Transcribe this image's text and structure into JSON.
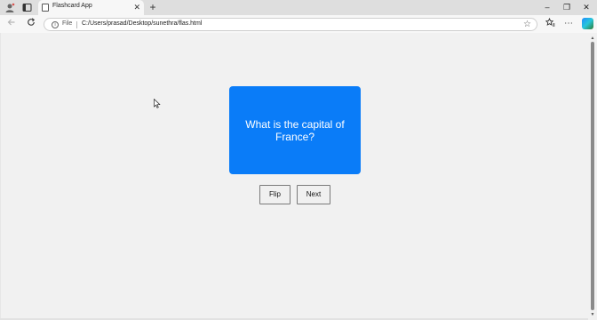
{
  "browser": {
    "tab": {
      "title": "Flashcard App",
      "close_glyph": "✕"
    },
    "new_tab_glyph": "+",
    "window_controls": {
      "minimize": "–",
      "restore": "❐",
      "close": "✕"
    },
    "address_bar": {
      "scheme_label": "File",
      "url": "C:/Users/prasad/Desktop/sunethra/flas.html"
    },
    "icons": {
      "profile": "profile-icon",
      "tab_actions": "tab-actions-icon",
      "back": "back-arrow-icon",
      "reload": "reload-icon",
      "info": "info-icon",
      "favorite": "star-icon",
      "favorites_bar": "favorites-icon",
      "more": "more-icon",
      "copilot": "copilot-icon"
    },
    "accent_color": "#0a7cf8"
  },
  "page": {
    "card": {
      "text": "What is the capital of France?"
    },
    "buttons": {
      "flip": "Flip",
      "next": "Next"
    }
  }
}
